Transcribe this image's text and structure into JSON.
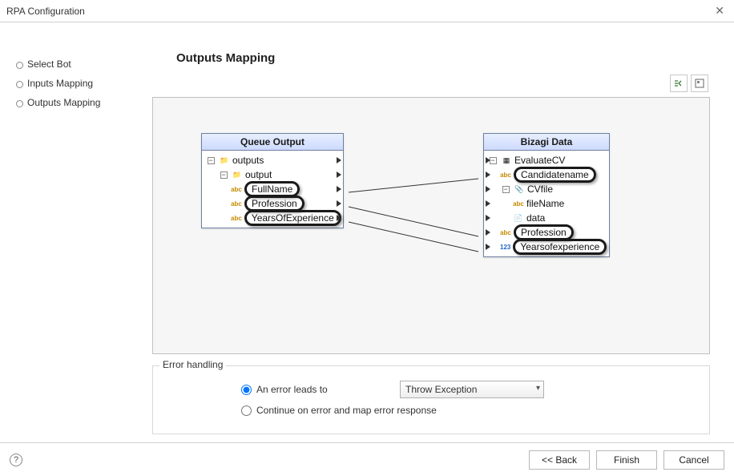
{
  "window": {
    "title": "RPA Configuration"
  },
  "sidebar": {
    "items": [
      {
        "label": "Select Bot"
      },
      {
        "label": "Inputs Mapping"
      },
      {
        "label": "Outputs Mapping"
      }
    ]
  },
  "main": {
    "title": "Outputs Mapping",
    "toolbar": {
      "btn1": "map-layout-icon",
      "btn2": "view-icon"
    }
  },
  "left_panel": {
    "title": "Queue Output",
    "rows": [
      {
        "label": "outputs",
        "indent": 0,
        "icon": "folder"
      },
      {
        "label": "output",
        "indent": 1,
        "icon": "folder"
      },
      {
        "label": "FullName",
        "indent": 2,
        "icon": "abc",
        "hl": true
      },
      {
        "label": "Profession",
        "indent": 2,
        "icon": "abc",
        "hl": true
      },
      {
        "label": "YearsOfExperience",
        "indent": 2,
        "icon": "abc",
        "hl": true
      }
    ]
  },
  "right_panel": {
    "title": "Bizagi Data",
    "rows": [
      {
        "label": "EvaluateCV",
        "indent": 0,
        "icon": "entity"
      },
      {
        "label": "Candidatename",
        "indent": 1,
        "icon": "abc",
        "hl": true
      },
      {
        "label": "CVfile",
        "indent": 1,
        "icon": "clip"
      },
      {
        "label": "fileName",
        "indent": 2,
        "icon": "abc"
      },
      {
        "label": "data",
        "indent": 2,
        "icon": "file"
      },
      {
        "label": "Profession",
        "indent": 1,
        "icon": "abc",
        "hl": true
      },
      {
        "label": "Yearsofexperience",
        "indent": 1,
        "icon": "num",
        "hl": true
      }
    ]
  },
  "error": {
    "legend": "Error handling",
    "opt1": "An error leads to",
    "opt2": "Continue on error and map error response",
    "select_value": "Throw Exception"
  },
  "footer": {
    "back": "<< Back",
    "finish": "Finish",
    "cancel": "Cancel"
  }
}
